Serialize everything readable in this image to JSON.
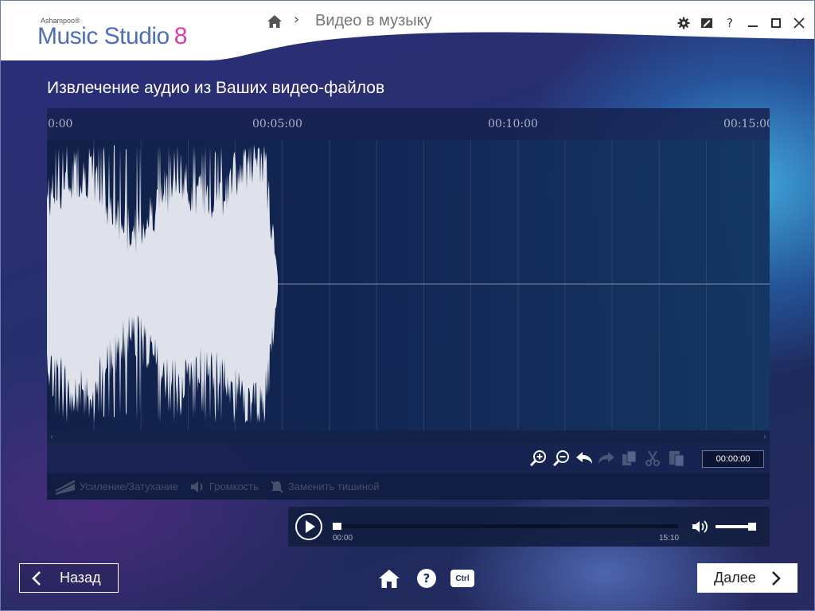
{
  "app": {
    "brand": "Ashampoo®",
    "name": "Music Studio",
    "version": "8"
  },
  "breadcrumb": {
    "separator": "›",
    "title": "Видео в музыку"
  },
  "window_buttons": {
    "help": "?"
  },
  "page": {
    "heading": "Извлечение аудио из Ваших видео-файлов"
  },
  "timeline": {
    "ticks": [
      "0:00",
      "00:05:00",
      "00:10:00",
      "00:15:00"
    ],
    "current_time": "00:00:00"
  },
  "scrollbar": {
    "left": "‹",
    "right": "›"
  },
  "effects": [
    {
      "label": "Усиление/Затухание",
      "icon": "fade-icon"
    },
    {
      "label": "Громкость",
      "icon": "volume-icon"
    },
    {
      "label": "Заменить тишиной",
      "icon": "mute-icon"
    }
  ],
  "player": {
    "position": "00:00",
    "duration": "15:10",
    "progress": 0.0,
    "volume": 0.85
  },
  "nav": {
    "back": "Назад",
    "next": "Далее",
    "help": "?",
    "ctrl": "Ctrl"
  },
  "colors": {
    "accent_blue": "#4d6fb8",
    "accent_magenta": "#d63fa8",
    "waveform": "#dfe2ea"
  }
}
